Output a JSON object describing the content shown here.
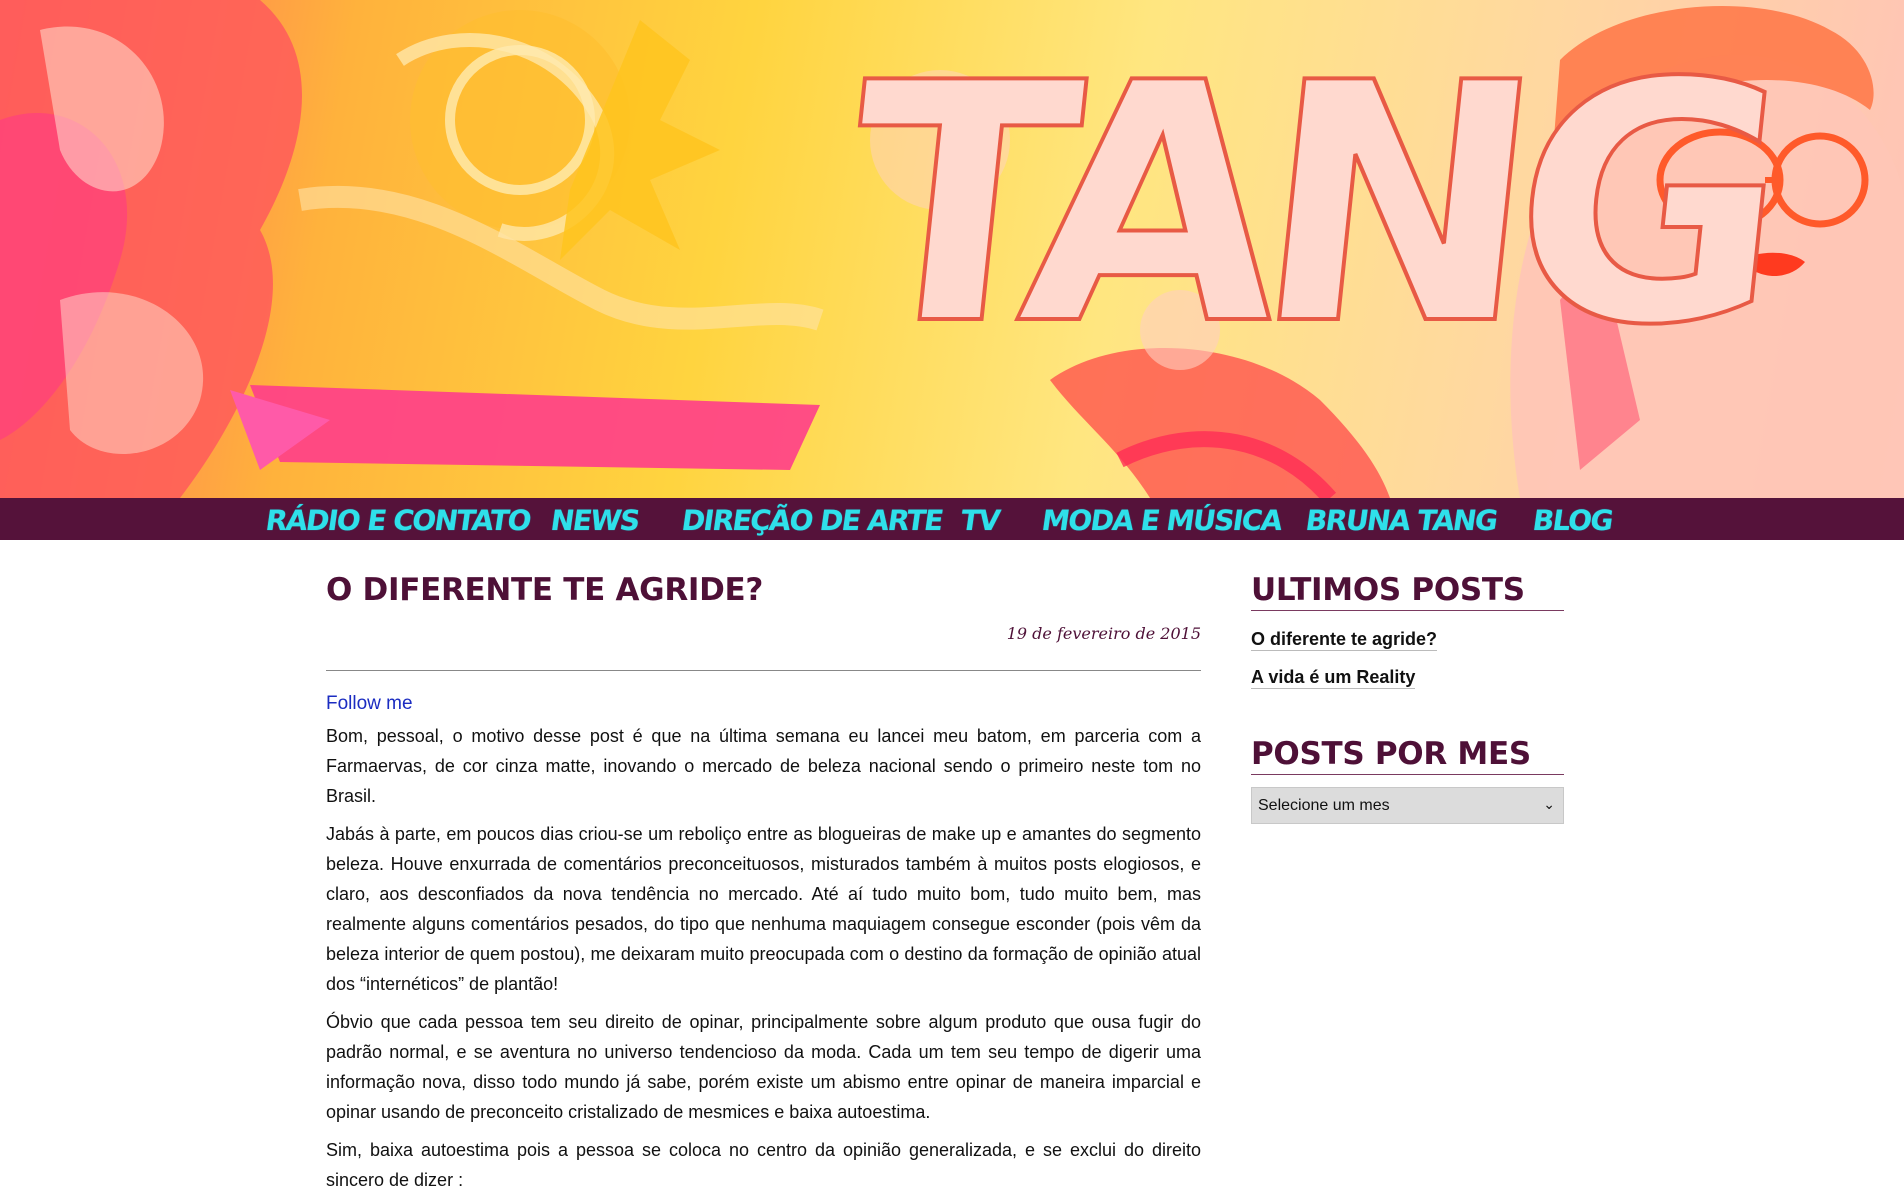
{
  "header": {
    "logo_text": "TANG",
    "colors": {
      "pink": "#ff4f8b",
      "orange": "#ff7a3c",
      "yellow": "#ffd43f",
      "peach": "#ffd9cf"
    }
  },
  "nav": {
    "background": "#55123a",
    "text_color": "#2fe0ea",
    "items": [
      {
        "label": "Rádio e Contato"
      },
      {
        "label": "News"
      },
      {
        "label": "Direção de Arte"
      },
      {
        "label": "TV"
      },
      {
        "label": "Moda e Música"
      },
      {
        "label": "Bruna Tang"
      },
      {
        "label": "Blog"
      }
    ]
  },
  "post": {
    "title": "O DIFERENTE TE AGRIDE?",
    "date": "19 de fevereiro de 2015",
    "follow_link": "Follow me",
    "paragraphs": [
      "Bom, pessoal, o motivo desse post é que na última semana eu lancei meu batom, em parceria com a Farmaervas, de cor cinza matte, inovando o mercado de beleza nacional sendo o primeiro neste tom no Brasil.",
      "Jabás à parte, em poucos dias criou-se um reboliço entre as blogueiras de make up e amantes do segmento beleza. Houve enxurrada de comentários preconceituosos, misturados também à muitos posts elogiosos, e claro, aos desconfiados da nova tendência no mercado. Até aí tudo muito bom, tudo muito bem, mas realmente alguns comentários pesados, do tipo que nenhuma maquiagem consegue esconder (pois vêm da beleza interior de quem postou), me deixaram muito preocupada com o destino da formação de opinião atual dos “internéticos” de plantão!",
      "Óbvio que cada pessoa tem seu direito de opinar, principalmente sobre algum produto que ousa fugir do padrão normal, e se aventura no universo tendencioso da moda. Cada um tem seu tempo de digerir uma informação nova, disso todo mundo já sabe, porém existe um abismo entre opinar de maneira imparcial e opinar usando de preconceito cristalizado de mesmices e baixa autoestima.",
      "Sim, baixa autoestima pois a pessoa se coloca no centro da opinião generalizada, e se exclui do direito sincero de dizer :"
    ]
  },
  "sidebar": {
    "recent_title": "ULTIMOS POSTS",
    "recent_posts": [
      {
        "label": "O diferente te agride?"
      },
      {
        "label": "A vida é um Reality"
      }
    ],
    "archive_title": "POSTS POR MES",
    "archive_select": "Selecione um mes"
  }
}
